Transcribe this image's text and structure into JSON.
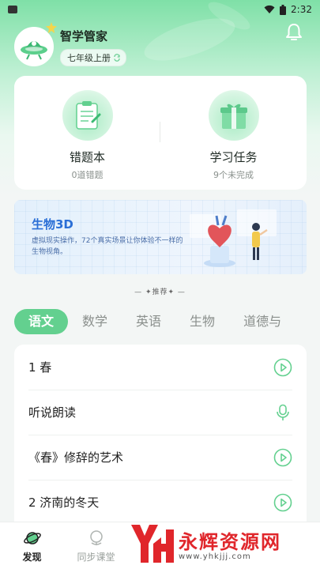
{
  "status_bar": {
    "time": "2:32"
  },
  "profile": {
    "nickname": "智学管家",
    "grade": "七年级上册"
  },
  "tools": [
    {
      "title": "错题本",
      "subtitle": "0道错题"
    },
    {
      "title": "学习任务",
      "subtitle": "9个未完成"
    }
  ],
  "banner": {
    "title": "生物3D",
    "description": "虚拟现实操作，72个真实场景让你体验不一样的生物视角。"
  },
  "recommend_label": "推荐",
  "subjects": [
    "语文",
    "数学",
    "英语",
    "生物",
    "道德与"
  ],
  "active_subject": "语文",
  "lessons": [
    {
      "text": "1  春",
      "action_icon": "play-icon"
    },
    {
      "text": "听说朗读",
      "action_icon": "microphone-icon"
    },
    {
      "text": "《春》修辞的艺术",
      "action_icon": "play-icon"
    },
    {
      "text": "2   济南的冬天",
      "action_icon": "play-icon"
    }
  ],
  "tabbar": [
    {
      "label": "发现",
      "icon": "planet-icon",
      "active": true
    },
    {
      "label": "同步课堂",
      "icon": "globe-icon",
      "active": false
    },
    {
      "label": "",
      "icon": "",
      "active": false
    },
    {
      "label": "",
      "icon": "",
      "active": false
    },
    {
      "label": "",
      "icon": "",
      "active": false
    }
  ],
  "watermark": {
    "brand": "永辉资源网",
    "url": "www.yhkjjj.com"
  },
  "colors": {
    "accent": "#63d08f",
    "banner_title": "#2b6fd6",
    "watermark_red": "#e0262b"
  }
}
